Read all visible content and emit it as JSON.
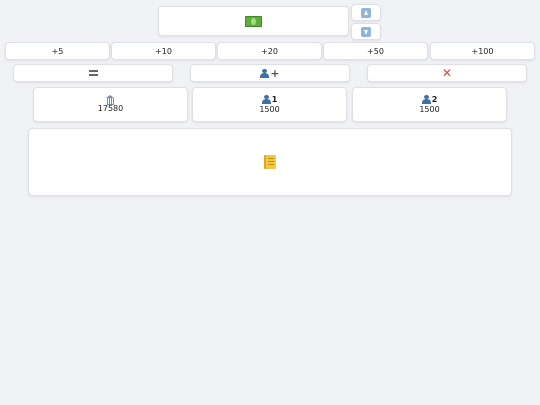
{
  "display": {
    "icon": "money-bills-icon"
  },
  "arrows": {
    "up_icon": "arrow-up-icon",
    "down_icon": "arrow-down-icon"
  },
  "increments": [
    "+5",
    "+10",
    "+20",
    "+50",
    "+100"
  ],
  "actions": {
    "equals_icon": "equals-icon",
    "add_player_icon": "add-player-icon",
    "clear_icon": "close-icon"
  },
  "players": [
    {
      "icon": "bank-icon",
      "label": "",
      "value": "17580"
    },
    {
      "icon": "person-icon",
      "label": "1",
      "value": "1500"
    },
    {
      "icon": "person-icon",
      "label": "2",
      "value": "1500"
    }
  ],
  "log": {
    "icon": "ledger-icon"
  },
  "colors": {
    "background": "#f0f2f5",
    "accent_close": "#e0443e",
    "money": "#5fae3d"
  }
}
